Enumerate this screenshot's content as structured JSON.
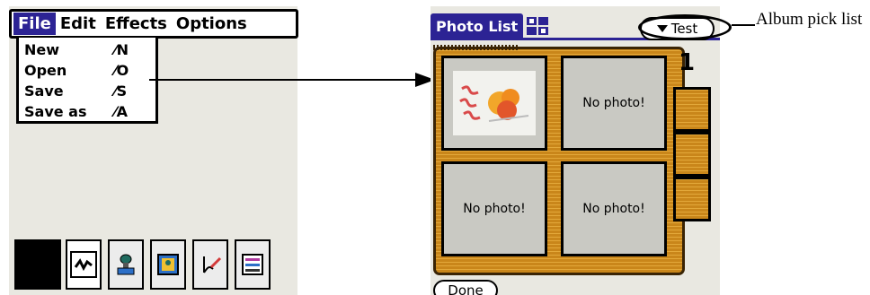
{
  "left_screen": {
    "menubar": {
      "items": [
        {
          "label": "File",
          "active": true
        },
        {
          "label": "Edit"
        },
        {
          "label": "Effects"
        },
        {
          "label": "Options"
        }
      ]
    },
    "file_menu": [
      {
        "label": "New",
        "shortcut": "⁄N"
      },
      {
        "label": "Open",
        "shortcut": "⁄O"
      },
      {
        "label": "Save",
        "shortcut": "⁄S"
      },
      {
        "label": "Save as",
        "shortcut": "⁄A"
      }
    ],
    "toolbar": {
      "tools": [
        "scribble-tool-icon",
        "stamp-tool-icon",
        "photo-tool-icon",
        "pen-tool-icon",
        "settings-tool-icon"
      ],
      "color_swatch": "#000000"
    }
  },
  "right_screen": {
    "title": "Photo List",
    "album_picker": "Test",
    "page_number": "1",
    "slots": [
      {
        "has_photo": true,
        "label": ""
      },
      {
        "has_photo": false,
        "label": "No photo!"
      },
      {
        "has_photo": false,
        "label": "No photo!"
      },
      {
        "has_photo": false,
        "label": "No photo!"
      }
    ],
    "done_label": "Done"
  },
  "callout": {
    "text": "Album pick list"
  },
  "colors": {
    "accent": "#2c2394",
    "album_wood": "#c9861a",
    "screen_bg": "#e9e8e1"
  }
}
